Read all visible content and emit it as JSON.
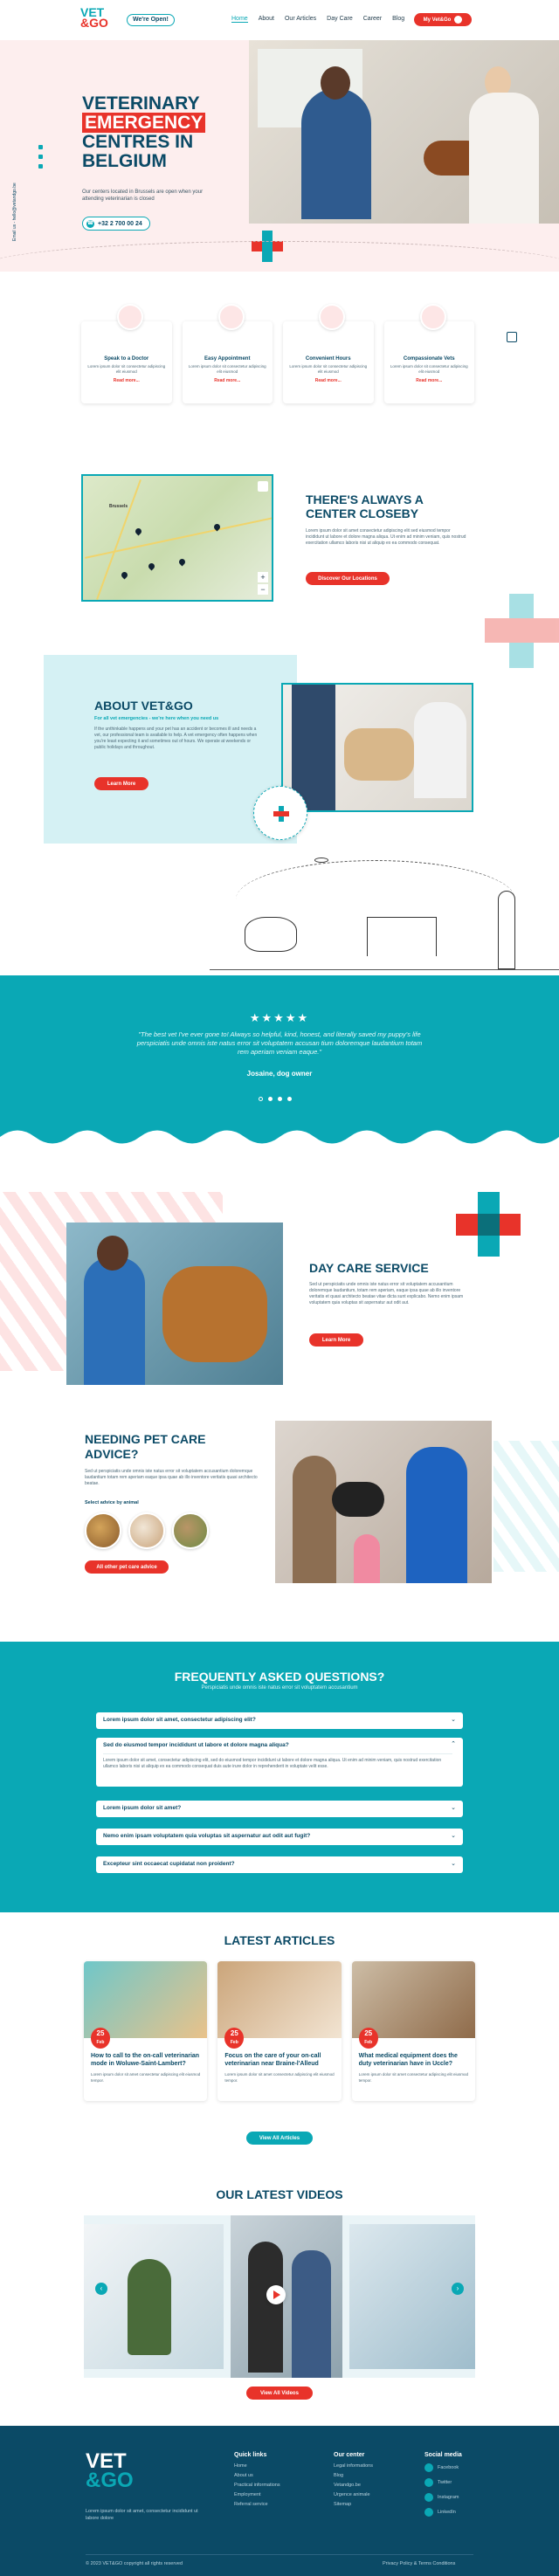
{
  "header": {
    "logo_line1": "VET",
    "logo_line2": "&GO",
    "open_badge": "We're Open!",
    "nav": [
      "Home",
      "About",
      "Our Articles",
      "Day Care",
      "Career",
      "Blog"
    ],
    "cta": "My Vet&Go"
  },
  "hero": {
    "line1": "VETERINARY",
    "line2": "EMERGENCY",
    "line3": "CENTRES IN",
    "line4": "BELGIUM",
    "desc": "Our centers located in Brussels are open when your attending veterinarian is closed",
    "phone": "+32 2 700 00 24",
    "side_email": "Email us - hello@vetandgo.be"
  },
  "services": [
    {
      "title": "Speak to a Doctor",
      "desc": "Lorem ipsum dolor sit consectetur adipiscing elit eiusmod",
      "link": "Read more..."
    },
    {
      "title": "Easy Appointment",
      "desc": "Lorem ipsum dolor sit consectetur adipiscing elit eiusmod",
      "link": "Read more..."
    },
    {
      "title": "Convenient Hours",
      "desc": "Lorem ipsum dolor sit consectetur adipiscing elit eiusmod",
      "link": "Read more..."
    },
    {
      "title": "Compassionate Vets",
      "desc": "Lorem ipsum dolor sit consectetur adipiscing elit eiusmod",
      "link": "Read more..."
    }
  ],
  "map_section": {
    "title_line1": "THERE'S ALWAYS A",
    "title_line2": "CENTER CLOSEBY",
    "desc": "Lorem ipsum dolor sit amet consectetur adipiscing elit sed eiusmod tempor incididunt ut labore et dolore magna aliqua. Ut enim ad minim veniam, quis nostrud exercitation ullamco laboris nisi ut aliquip ex ea commodo consequat.",
    "button": "Discover Our Locations",
    "city": "Brussels"
  },
  "about": {
    "title": "ABOUT VET&GO",
    "subtitle": "For all vet emergencies - we're here when you need us",
    "desc": "If the unthinkable happens and your pet has an accident or becomes ill and needs a vet, our professional team is available to help. A vet emergency often happens when you're least expecting it and sometimes out of hours. We operate at weekends or public holidays and throughout.",
    "button": "Learn More"
  },
  "testimonial": {
    "stars": "★★★★★",
    "quote": "\"The best vet I've ever gone to! Always so helpful, kind, honest, and literally saved my puppy's life perspiciatis unde omnis iste natus error sit voluptatem accusan tium doloremque laudantium totam rem aperiam veniam eaque.\"",
    "author": "Josaine, dog owner"
  },
  "daycare": {
    "title": "DAY CARE SERVICE",
    "desc": "Sed ut perspiciatis unde omnis iste natus error sit voluptatem accusantium doloremque laudantium, totam rem aperiam, eaque ipsa quae ab illo inventore veritatis et quasi architecto beatae vitae dicta sunt explicabo. Nemo enim ipsam voluptatem quia voluptas sit aspernatur aut odit aut.",
    "button": "Learn More"
  },
  "advice": {
    "title_line1": "NEEDING PET CARE",
    "title_line2": "ADVICE?",
    "desc": "Sed ut perspiciatis unde omnis iste natus error sit voluptatem accusantium doloremque laudantium totam rem aperiam eaque ipsa quae ab illo inventore veritatis quasi architecto beatae.",
    "label": "Select advice by animal",
    "button": "All other pet care advice"
  },
  "faq": {
    "title": "FREQUENTLY ASKED QUESTIONS?",
    "subtitle": "Perspiciatis unde omnis iste natus error sit voluptatem accusantium",
    "items": [
      {
        "q": "Lorem ipsum dolor sit amet, consectetur adipiscing elit?",
        "a": ""
      },
      {
        "q": "Sed do eiusmod tempor incididunt ut labore et dolore magna aliqua?",
        "a": "Lorem ipsum dolor sit amet, consectetur adipiscing elit, sed do eiusmod tempor incididunt ut labore et dolore magna aliqua. Ut enim ad minim veniam, quis nostrud exercitation ullamco laboris nisi ut aliquip ex ea commodo consequat duis aute irure dolor in reprehenderit in voluptate velit esse."
      },
      {
        "q": "Lorem ipsum dolor sit amet?",
        "a": ""
      },
      {
        "q": "Nemo enim ipsam voluptatem quia voluptas sit aspernatur aut odit aut fugit?",
        "a": ""
      },
      {
        "q": "Excepteur sint occaecat cupidatat non proident?",
        "a": ""
      }
    ]
  },
  "articles": {
    "title": "LATEST ARTICLES",
    "items": [
      {
        "day": "25",
        "month": "Feb",
        "title": "How to call to the on-call veterinarian mode in Woluwe-Saint-Lambert?",
        "desc": "Lorem ipsum dolor sit amet consectetur adipiscing elit eiusmod tempor."
      },
      {
        "day": "25",
        "month": "Feb",
        "title": "Focus on the care of your on-call veterinarian near Braine-l'Alleud",
        "desc": "Lorem ipsum dolor sit amet consectetur adipiscing elit eiusmod tempor."
      },
      {
        "day": "25",
        "month": "Feb",
        "title": "What medical equipment does the duty veterinarian have in Uccle?",
        "desc": "Lorem ipsum dolor sit amet consectetur adipiscing elit eiusmod tempor."
      }
    ],
    "button": "View All Articles"
  },
  "videos": {
    "title": "OUR LATEST VIDEOS",
    "button": "View All Videos"
  },
  "footer": {
    "logo_line1": "VET",
    "logo_line2": "&GO",
    "desc": "Lorem ipsum dolor sit amet, consectetur incididunt ut labore dolore",
    "quick_title": "Quick links",
    "quick": [
      "Home",
      "About us",
      "Practical informations",
      "Employment",
      "Referral service"
    ],
    "center_title": "Our center",
    "center": [
      "Legal informations",
      "Blog",
      "Vetandgo.be",
      "Urgence animale",
      "Sitemap"
    ],
    "social_title": "Social media",
    "social": [
      "Facebook",
      "Twitter",
      "Instagram",
      "LinkedIn"
    ],
    "copyright": "© 2023 VET&GO copyright all rights reserved",
    "policy": "Privacy Policy & Terms Conditions"
  },
  "colors": {
    "teal": "#0aa8b5",
    "red": "#e8332a",
    "navy": "#0b4a66"
  }
}
